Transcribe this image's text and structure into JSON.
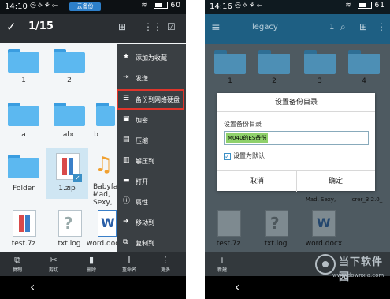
{
  "left": {
    "status": {
      "time": "14:10",
      "app_badge": "云备份",
      "battery": "60"
    },
    "toolbar": {
      "selection_count": "1/15"
    },
    "grid": [
      {
        "label": "1",
        "type": "folder"
      },
      {
        "label": "2",
        "type": "folder"
      },
      {
        "label": "a",
        "type": "folder"
      },
      {
        "label": "abc",
        "type": "folder"
      },
      {
        "label": "b",
        "type": "folder"
      },
      {
        "label": "Folder",
        "type": "folder"
      },
      {
        "label": "1.zip",
        "type": "zip"
      },
      {
        "label": "Babyface -",
        "label2": "Mad, Sexy,",
        "type": "music"
      },
      {
        "label": "test.7z",
        "type": "archive"
      },
      {
        "label": "txt.log",
        "type": "log"
      },
      {
        "label": "word.docx",
        "type": "doc"
      }
    ],
    "menu": [
      {
        "label": "添加为收藏",
        "icon": "star-icon"
      },
      {
        "label": "发送",
        "icon": "send-icon"
      },
      {
        "label": "备份到网络硬盘",
        "icon": "backup-icon"
      },
      {
        "label": "加密",
        "icon": "lock-icon"
      },
      {
        "label": "压缩",
        "icon": "compress-icon"
      },
      {
        "label": "解压到",
        "icon": "extract-icon"
      },
      {
        "label": "打开",
        "icon": "open-icon"
      },
      {
        "label": "属性",
        "icon": "info-icon"
      },
      {
        "label": "移动到",
        "icon": "move-icon"
      },
      {
        "label": "复制到",
        "icon": "copy-icon"
      }
    ],
    "actions": [
      {
        "label": "复制",
        "icon": "copy-icon"
      },
      {
        "label": "剪切",
        "icon": "cut-icon"
      },
      {
        "label": "删除",
        "icon": "trash-icon"
      },
      {
        "label": "重命名",
        "icon": "rename-icon"
      },
      {
        "label": "更多",
        "icon": "more-icon"
      }
    ]
  },
  "right": {
    "status": {
      "time": "14:16",
      "battery": "61"
    },
    "toolbar": {
      "title": "legacy",
      "num": "1"
    },
    "folders": [
      "1",
      "2",
      "3",
      "4"
    ],
    "dialog": {
      "title": "设置备份目录",
      "label": "设置备份目录",
      "input_value": "M040的ES备份",
      "checkbox_label": "设置为默认",
      "cancel": "取消",
      "ok": "确定"
    },
    "bottom_labels": [
      "Mad, Sexy,",
      "lcrer_3.2.0_"
    ],
    "files": [
      "test.7z",
      "txt.log",
      "word.docx"
    ],
    "action_first": "新建"
  },
  "watermark": {
    "text": "当下软件园",
    "url": "www.downxia.com"
  }
}
